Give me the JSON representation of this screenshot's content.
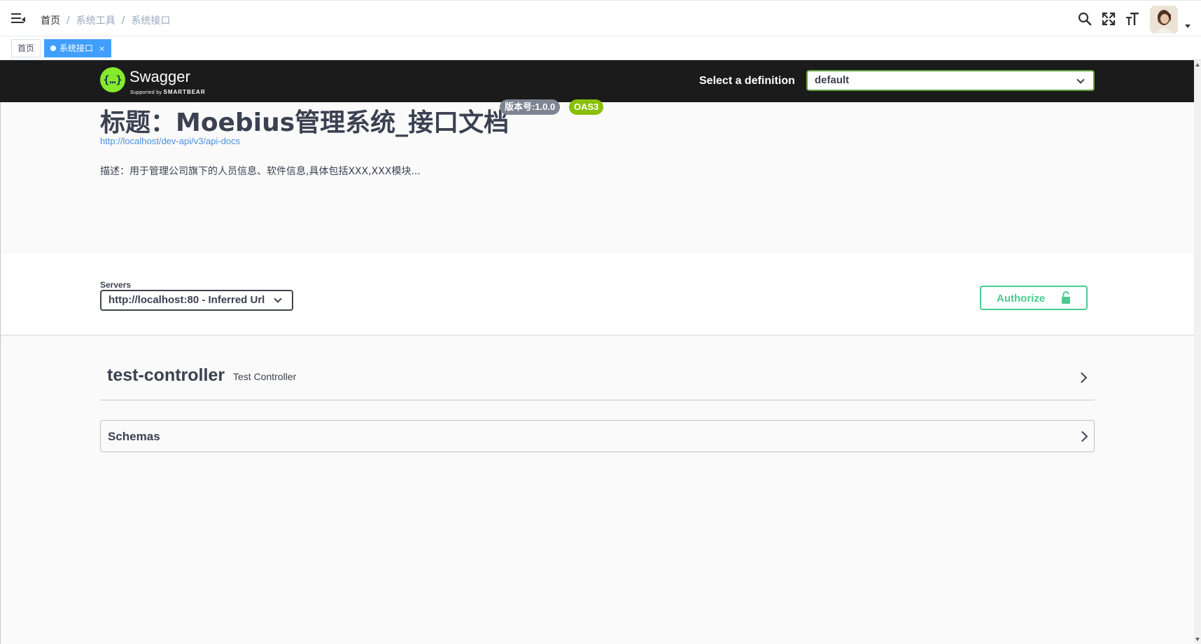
{
  "navbar": {
    "breadcrumb": [
      "首页",
      "系统工具",
      "系统接口"
    ],
    "separator": "/"
  },
  "tags": [
    {
      "label": "首页",
      "active": false
    },
    {
      "label": "系统接口",
      "active": true,
      "close": "×"
    }
  ],
  "swagger": {
    "brand": "Swagger",
    "logo_glyph": "{…}",
    "supported_by": "Supported by",
    "smartbear": "SMARTBEAR",
    "definition_label": "Select a definition",
    "definition_value": "default",
    "title": "标题：Moebius管理系统_接口文档",
    "version_badge": "版本号:1.0.0",
    "oas_badge": "OAS3",
    "api_docs_url": "http://localhost/dev-api/v3/api-docs",
    "description": "描述：用于管理公司旗下的人员信息、软件信息,具体包括XXX,XXX模块...",
    "servers_label": "Servers",
    "servers_value": "http://localhost:80 - Inferred Url",
    "authorize_label": "Authorize",
    "controller_name": "test-controller",
    "controller_desc": "Test Controller",
    "schemas_label": "Schemas"
  },
  "colors": {
    "accent_blue": "#409eff",
    "swagger_green": "#85ea2d",
    "authorize_green": "#49cc90",
    "oas_green": "#89bf04"
  }
}
